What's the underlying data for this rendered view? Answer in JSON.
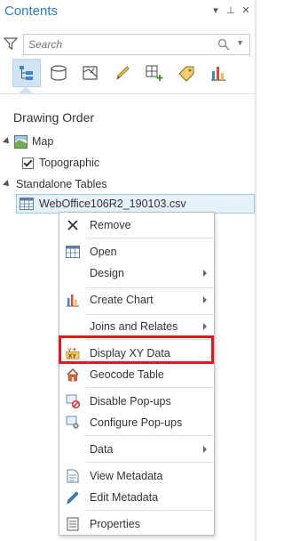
{
  "pane": {
    "title": "Contents",
    "controls": [
      "▾",
      "⊥",
      "✕"
    ]
  },
  "search": {
    "placeholder": "Search",
    "value": ""
  },
  "toolbar": {
    "buttons": [
      {
        "name": "list-by-drawing-order-icon",
        "active": true
      },
      {
        "name": "list-by-data-source-icon"
      },
      {
        "name": "list-by-selection-icon"
      },
      {
        "name": "list-by-editing-icon"
      },
      {
        "name": "list-by-snapping-icon"
      },
      {
        "name": "list-by-labeling-icon"
      },
      {
        "name": "list-by-charts-icon"
      }
    ]
  },
  "tree": {
    "section": "Drawing Order",
    "map": "Map",
    "topographic": "Topographic",
    "standalone": "Standalone Tables",
    "table": "WebOffice106R2_190103.csv"
  },
  "menu": {
    "remove": "Remove",
    "open": "Open",
    "design": "Design",
    "create_chart": "Create Chart",
    "joins": "Joins and Relates",
    "display_xy": "Display XY Data",
    "geocode": "Geocode Table",
    "disable_popups": "Disable Pop-ups",
    "configure_popups": "Configure Pop-ups",
    "data": "Data",
    "view_metadata": "View Metadata",
    "edit_metadata": "Edit Metadata",
    "properties": "Properties"
  },
  "colors": {
    "accent": "#2f7dc5",
    "highlight_outline": "#e3181f",
    "selection_bg": "#e5f1fb"
  }
}
